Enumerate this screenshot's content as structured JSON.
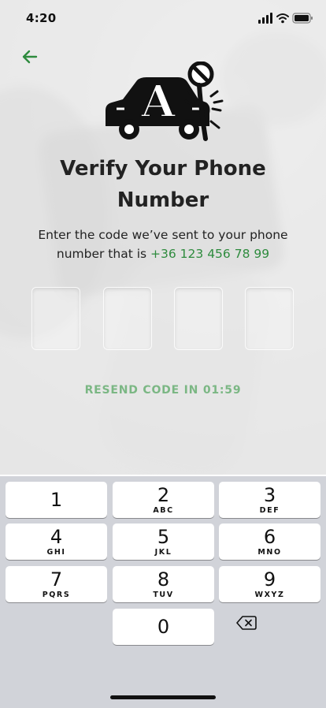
{
  "status_bar": {
    "time": "4:20"
  },
  "header": {
    "back_icon": "arrow-left-icon",
    "logo_letter": "A"
  },
  "page": {
    "title": "Verify Your Phone Number",
    "subtitle_text": "Enter the code we’ve sent to your phone number that is",
    "phone_number": "+36 123 456 78 99",
    "resend_label": "RESEND CODE IN 01:59"
  },
  "colors": {
    "accent": "#2e8b3e",
    "resend": "#7bb784",
    "keyboard_bg": "#d1d3d9"
  },
  "otp": {
    "values": [
      "",
      "",
      "",
      ""
    ]
  },
  "keypad": {
    "keys": [
      {
        "num": "1",
        "letters": ""
      },
      {
        "num": "2",
        "letters": "ABC"
      },
      {
        "num": "3",
        "letters": "DEF"
      },
      {
        "num": "4",
        "letters": "GHI"
      },
      {
        "num": "5",
        "letters": "JKL"
      },
      {
        "num": "6",
        "letters": "MNO"
      },
      {
        "num": "7",
        "letters": "PQRS"
      },
      {
        "num": "8",
        "letters": "TUV"
      },
      {
        "num": "9",
        "letters": "WXYZ"
      },
      {
        "num": "0",
        "letters": ""
      }
    ],
    "delete_icon": "backspace-icon"
  }
}
